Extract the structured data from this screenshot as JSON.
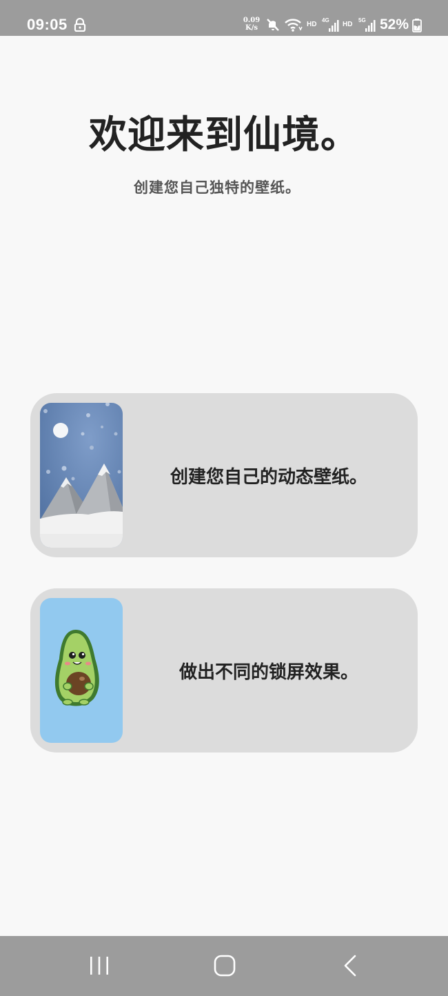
{
  "status_bar": {
    "time": "09:05",
    "net_speed_value": "0.09",
    "net_speed_unit": "K/s",
    "hd_label_1": "HD",
    "signal_1_label": "4G",
    "hd_label_2": "HD",
    "signal_2_label": "5G",
    "battery": "52%"
  },
  "header": {
    "title": "欢迎来到仙境。",
    "subtitle": "创建您自己独特的壁纸。"
  },
  "cards": [
    {
      "label": "创建您自己的动态壁纸。",
      "thumbnail": "snowy-mountain-wallpaper"
    },
    {
      "label": "做出不同的锁屏效果。",
      "thumbnail": "avocado-wallpaper"
    }
  ],
  "nav_bar": {
    "recents_icon": "recents-icon",
    "home_icon": "home-icon",
    "back_icon": "back-icon"
  },
  "colors": {
    "status_bar_bg": "#9c9c9c",
    "page_bg": "#f8f8f8",
    "card_bg": "#dcdcdc",
    "title_text": "#222222",
    "subtitle_text": "#555555"
  }
}
